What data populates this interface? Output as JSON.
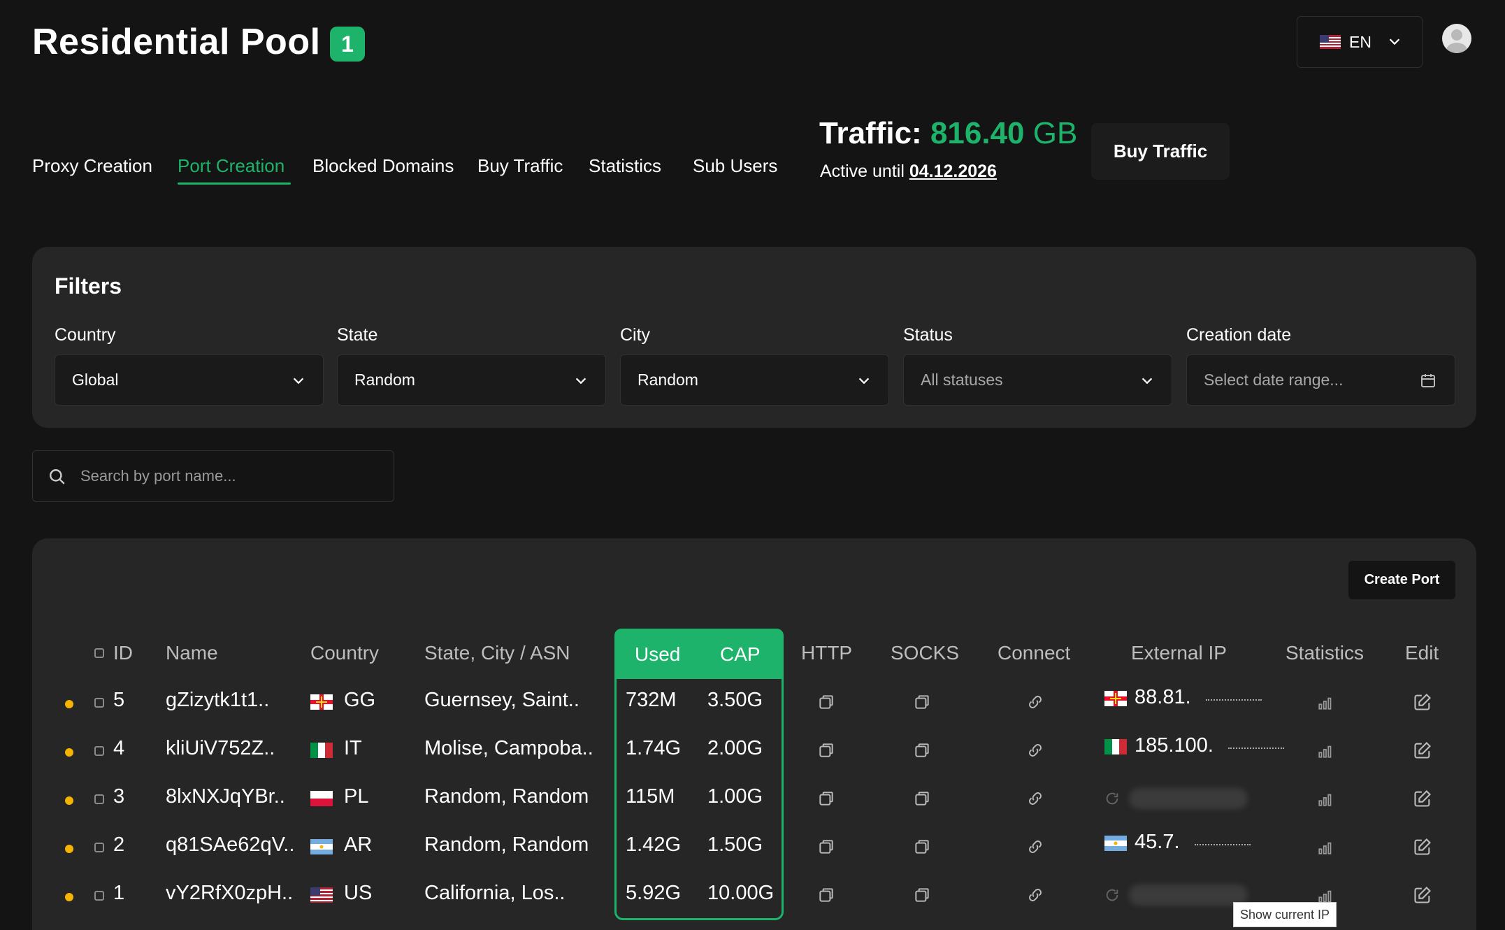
{
  "header": {
    "title": "Residential Pool",
    "badge": "1",
    "language": "EN"
  },
  "tabs": [
    {
      "label": "Proxy Creation",
      "active": false
    },
    {
      "label": "Port Creation",
      "active": true
    },
    {
      "label": "Blocked Domains",
      "active": false
    },
    {
      "label": "Buy Traffic",
      "active": false
    },
    {
      "label": "Statistics",
      "active": false
    },
    {
      "label": "Sub Users",
      "active": false
    }
  ],
  "traffic": {
    "label": "Traffic:",
    "value": "816.40",
    "unit": "GB",
    "active_label": "Active until",
    "active_date": "04.12.2026",
    "buy_button": "Buy Traffic"
  },
  "filters": {
    "title": "Filters",
    "country": {
      "label": "Country",
      "value": "Global"
    },
    "state": {
      "label": "State",
      "value": "Random"
    },
    "city": {
      "label": "City",
      "value": "Random"
    },
    "status": {
      "label": "Status",
      "placeholder": "All statuses"
    },
    "creation_date": {
      "label": "Creation date",
      "placeholder": "Select date range..."
    }
  },
  "search": {
    "placeholder": "Search by port name..."
  },
  "table": {
    "create_button": "Create Port",
    "columns": {
      "id": "ID",
      "name": "Name",
      "country": "Country",
      "state_city": "State, City / ASN",
      "used": "Used",
      "cap": "CAP",
      "http": "HTTP",
      "socks": "SOCKS",
      "connect": "Connect",
      "external_ip": "External IP",
      "statistics": "Statistics",
      "edit": "Edit"
    },
    "rows": [
      {
        "id": "5",
        "name": "gZizytk1t1..",
        "country": "GG",
        "location": "Guernsey, Saint..",
        "used": "732M",
        "cap": "3.50G",
        "ip": "88.81.",
        "ip_visible": true
      },
      {
        "id": "4",
        "name": "kliUiV752Z..",
        "country": "IT",
        "location": "Molise, Campoba..",
        "used": "1.74G",
        "cap": "2.00G",
        "ip": "185.100.",
        "ip_visible": true
      },
      {
        "id": "3",
        "name": "8lxNXJqYBr..",
        "country": "PL",
        "location": "Random, Random",
        "used": "115M",
        "cap": "1.00G",
        "ip": "",
        "ip_visible": false
      },
      {
        "id": "2",
        "name": "q81SAe62qV..",
        "country": "AR",
        "location": "Random, Random",
        "used": "1.42G",
        "cap": "1.50G",
        "ip": "45.7.",
        "ip_visible": true
      },
      {
        "id": "1",
        "name": "vY2RfX0zpH..",
        "country": "US",
        "location": "California, Los..",
        "used": "5.92G",
        "cap": "10.00G",
        "ip": "",
        "ip_visible": false
      }
    ],
    "tooltip": "Show current IP"
  },
  "colors": {
    "accent": "#1db36a",
    "status_dot": "#f5b400",
    "background": "#141414",
    "panel": "#262626"
  }
}
